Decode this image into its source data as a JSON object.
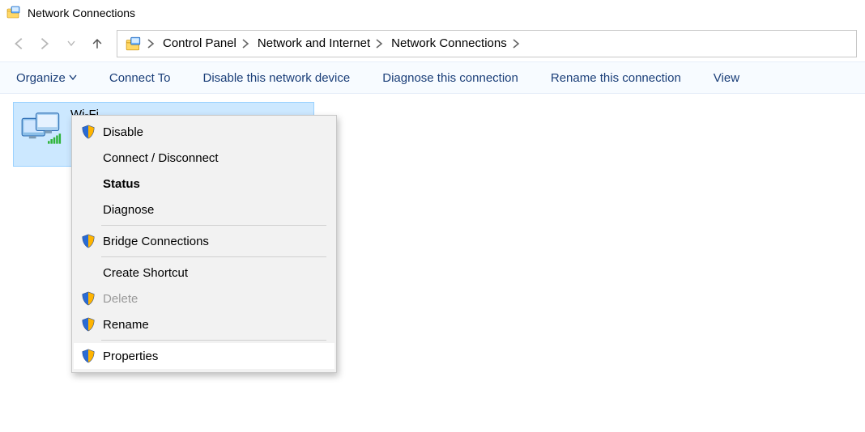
{
  "window": {
    "title": "Network Connections"
  },
  "breadcrumb": {
    "items": [
      {
        "label": "Control Panel"
      },
      {
        "label": "Network and Internet"
      },
      {
        "label": "Network Connections"
      }
    ]
  },
  "commands": {
    "organize": "Organize",
    "connect_to": "Connect To",
    "disable": "Disable this network device",
    "diagnose": "Diagnose this connection",
    "rename": "Rename this connection",
    "view": "View"
  },
  "connection": {
    "name": "Wi-Fi"
  },
  "context_menu": {
    "disable": "Disable",
    "connect_disconnect": "Connect / Disconnect",
    "status": "Status",
    "diagnose": "Diagnose",
    "bridge": "Bridge Connections",
    "create_shortcut": "Create Shortcut",
    "delete": "Delete",
    "rename": "Rename",
    "properties": "Properties"
  }
}
